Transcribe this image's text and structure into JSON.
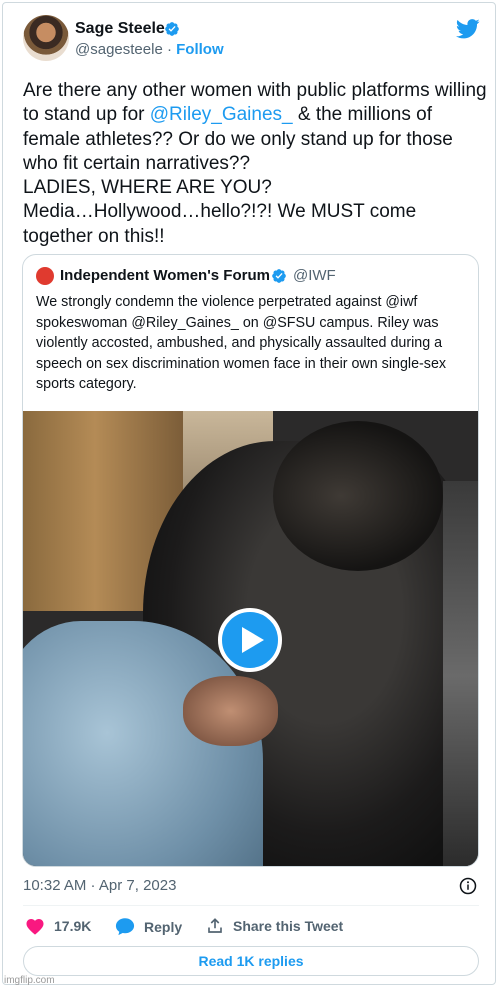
{
  "author": {
    "name": "Sage Steele",
    "handle": "@sagesteele",
    "separator": " · ",
    "follow_label": "Follow"
  },
  "tweet": {
    "text_before": "Are there any other women with public platforms willing to stand up for ",
    "mention": "@Riley_Gaines_",
    "text_after": " & the millions of female athletes?? Or do we only stand up for those who fit certain narratives??\nLADIES, WHERE ARE YOU?\nMedia…Hollywood…hello?!?! We MUST come together on this!!"
  },
  "quote": {
    "logo_text": "Independent",
    "name": "Independent Women's Forum",
    "handle": "@IWF",
    "text": "We strongly condemn the violence perpetrated against @iwf spokeswoman @Riley_Gaines_ on @SFSU campus. Riley was violently accosted, ambushed, and physically assaulted during a speech on sex discrimination women face in their own single-sex sports category."
  },
  "meta": {
    "timestamp": "10:32 AM · Apr 7, 2023"
  },
  "actions": {
    "likes": "17.9K",
    "reply": "Reply",
    "share": "Share this Tweet",
    "read_replies": "Read 1K replies"
  },
  "watermark": "imgflip.com",
  "colors": {
    "accent": "#1d9bf0",
    "like": "#f91880",
    "muted": "#536471"
  },
  "icons": [
    "verified-icon",
    "twitter-bird-icon",
    "play-icon",
    "info-icon",
    "heart-icon",
    "reply-icon",
    "share-icon"
  ]
}
